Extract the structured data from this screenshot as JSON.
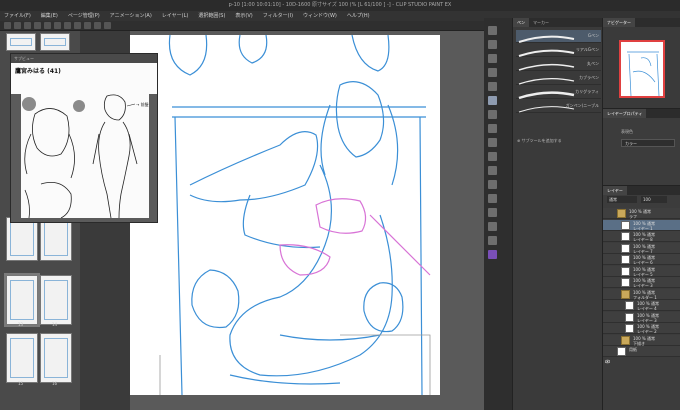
{
  "window": {
    "title": "p-10 [1:00 10:01:10] - 10D-1600 原寸サイズ 100 (% [L 61/100 ] -] - CLIP STUDIO PAINT EX"
  },
  "menu": {
    "items": [
      "ファイル(F)",
      "編集(E)",
      "ページ管理(P)",
      "アニメーション(A)",
      "レイヤー(L)",
      "選択範囲(S)",
      "表示(V)",
      "フィルター(I)",
      "ウィンドウ(W)",
      "ヘルプ(H)"
    ]
  },
  "pages": {
    "numbers": [
      "13",
      "14",
      "15",
      "16",
      "17"
    ]
  },
  "reference": {
    "window_title": "サブビュー",
    "name": "鷹宮みはる (41)",
    "arrow_label": "→ 前髪"
  },
  "subtool": {
    "tabs": [
      "ペン",
      "マーカー"
    ],
    "brushes": [
      "Gペン",
      "リアルGペン",
      "丸ペン",
      "カブラペン",
      "カリグラフィ",
      "ガンペン(ニーブル"
    ],
    "add_label": "サブツールを追加する"
  },
  "navigator": {
    "tab": "ナビゲーター"
  },
  "properties": {
    "tab": "レイヤープロパティ",
    "expression_label": "表現色",
    "expression_value": "カラー"
  },
  "layers": {
    "tab": "レイヤー",
    "blend_mode": "通常",
    "opacity": "100",
    "rows": [
      {
        "name": "100 % 通常",
        "sub": "ラフ",
        "indent": 0,
        "folder": true,
        "selected": false
      },
      {
        "name": "100 % 通常",
        "sub": "レイヤー 1",
        "indent": 1,
        "folder": false,
        "selected": true
      },
      {
        "name": "100 % 通常",
        "sub": "レイヤー 8",
        "indent": 1,
        "folder": false,
        "selected": false
      },
      {
        "name": "100 % 通常",
        "sub": "レイヤー 7",
        "indent": 1,
        "folder": false,
        "selected": false
      },
      {
        "name": "100 % 通常",
        "sub": "レイヤー 6",
        "indent": 1,
        "folder": false,
        "selected": false
      },
      {
        "name": "100 % 通常",
        "sub": "レイヤー 5",
        "indent": 1,
        "folder": false,
        "selected": false
      },
      {
        "name": "100 % 通常",
        "sub": "レイヤー 3",
        "indent": 1,
        "folder": false,
        "selected": false
      },
      {
        "name": "100 % 通常",
        "sub": "フォルダー 1",
        "indent": 1,
        "folder": true,
        "selected": false
      },
      {
        "name": "100 % 通常",
        "sub": "レイヤー 4",
        "indent": 2,
        "folder": false,
        "selected": false
      },
      {
        "name": "100 % 通常",
        "sub": "レイヤー 3",
        "indent": 2,
        "folder": false,
        "selected": false
      },
      {
        "name": "100 % 通常",
        "sub": "レイヤー 2",
        "indent": 2,
        "folder": false,
        "selected": false
      },
      {
        "name": "100 % 通常",
        "sub": "下描き",
        "indent": 1,
        "folder": true,
        "selected": false
      },
      {
        "name": "用紙",
        "sub": "",
        "indent": 0,
        "folder": false,
        "selected": false
      }
    ]
  },
  "colors": {
    "sketch_blue": "#3b8fd6",
    "sketch_pink": "#d873d6",
    "sketch_gray": "#9a9a9a",
    "selection": "#5a6f86",
    "nav_frame": "#e04040"
  }
}
